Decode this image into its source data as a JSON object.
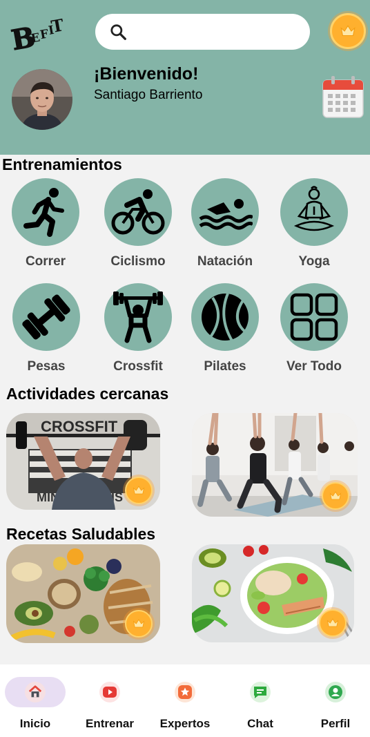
{
  "header": {
    "logo_text": "BEFIT",
    "search": {
      "placeholder": "",
      "value": ""
    },
    "welcome": "¡Bienvenido!",
    "username": "Santiago Barriento"
  },
  "workouts": {
    "title": "Entrenamientos",
    "items": [
      {
        "label": "Correr",
        "icon": "running-icon"
      },
      {
        "label": "Ciclismo",
        "icon": "cycling-icon"
      },
      {
        "label": "Natación",
        "icon": "swimming-icon"
      },
      {
        "label": "Yoga",
        "icon": "yoga-icon"
      },
      {
        "label": "Pesas",
        "icon": "dumbbell-icon"
      },
      {
        "label": "Crossfit",
        "icon": "weightlifting-icon"
      },
      {
        "label": "Pilates",
        "icon": "pilates-ball-icon"
      },
      {
        "label": "Ver Todo",
        "icon": "grid-icon"
      }
    ]
  },
  "nearby": {
    "title": "Actividades cercanas",
    "cards": [
      {
        "photo": "crossfit-gym-photo",
        "sign_text": "CROSSFIT",
        "sign_bottom": "MINNEAPOLIS"
      },
      {
        "photo": "yoga-class-photo"
      }
    ]
  },
  "recipes": {
    "title": "Recetas Saludables",
    "cards": [
      {
        "photo": "healthy-foods-photo"
      },
      {
        "photo": "salad-bowl-photo"
      }
    ]
  },
  "nav": {
    "items": [
      {
        "label": "Inicio",
        "icon": "home-icon",
        "active": true
      },
      {
        "label": "Entrenar",
        "icon": "play-icon",
        "active": false
      },
      {
        "label": "Expertos",
        "icon": "star-icon",
        "active": false
      },
      {
        "label": "Chat",
        "icon": "chat-icon",
        "active": false
      },
      {
        "label": "Perfil",
        "icon": "profile-icon",
        "active": false
      }
    ]
  },
  "colors": {
    "brand": "#84b4a7",
    "premium": "#ffb02e",
    "nav_active": "#e8def3"
  }
}
